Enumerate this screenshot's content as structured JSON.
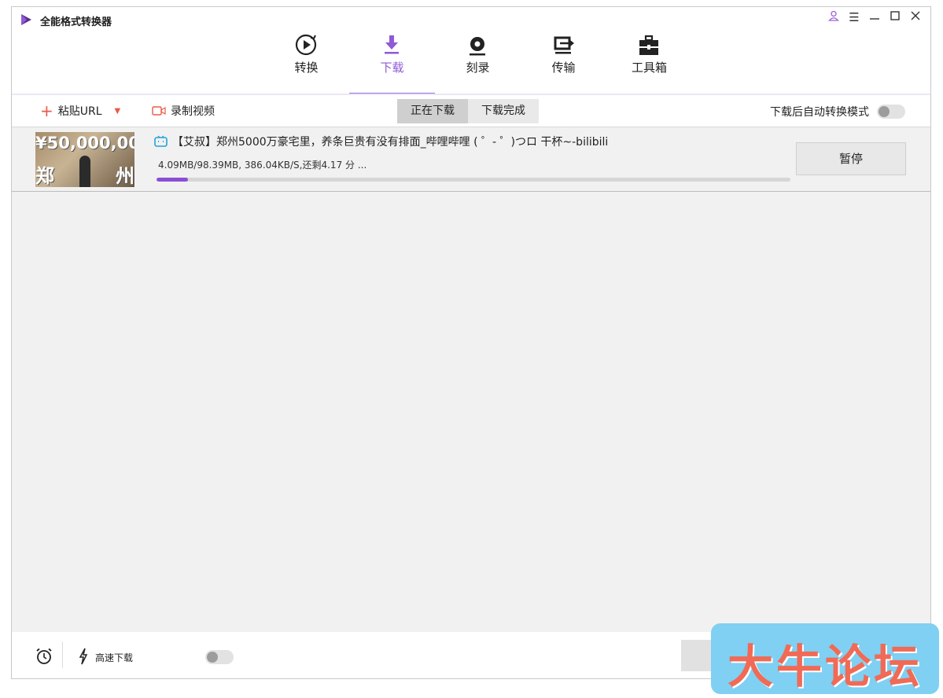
{
  "app": {
    "title": "全能格式转换器"
  },
  "nav": {
    "tabs": [
      {
        "label": "转换",
        "icon": "convert-icon"
      },
      {
        "label": "下载",
        "icon": "download-icon",
        "active": true
      },
      {
        "label": "刻录",
        "icon": "burn-disc-icon"
      },
      {
        "label": "传输",
        "icon": "transfer-icon"
      },
      {
        "label": "工具箱",
        "icon": "toolbox-icon"
      }
    ]
  },
  "toolbar": {
    "paste_url_label": "粘贴URL",
    "record_label": "录制视频",
    "segment": {
      "downloading": "正在下载",
      "completed": "下载完成"
    },
    "auto_convert_label": "下载后自动转换模式",
    "auto_convert_on": false
  },
  "downloads": [
    {
      "thumbnail_text": "¥50,000,00",
      "thumbnail_left": "郑",
      "thumbnail_right": "州",
      "source_icon": "bilibili-icon",
      "title": "【艾叔】郑州5000万豪宅里，养条巨贵有没有排面_哔哩哔哩 ( ゜- ゜)つロ 干杯~-bilibili",
      "status": "4.09MB/98.39MB, 386.04KB/S,还剩4.17 分 ...",
      "progress_percent": 5,
      "action_label": "暂停"
    }
  ],
  "bottom": {
    "high_speed_label": "高速下载",
    "high_speed_on": false
  },
  "watermark": {
    "text": "大牛论坛"
  },
  "colors": {
    "accent": "#8e5ad6",
    "progress": "#8b4fd6",
    "paste_plus": "#e85b4a"
  }
}
